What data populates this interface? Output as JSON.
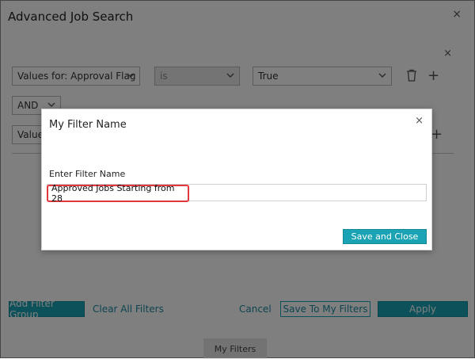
{
  "dialog": {
    "title": "Advanced Job Search",
    "close_glyph": "×",
    "inner_close_glyph": "×"
  },
  "filter_row_1": {
    "field_label": "Values for:  Approval Flag",
    "operator": "is",
    "value": "True",
    "add_glyph": "+"
  },
  "conjunction": {
    "value": "AND"
  },
  "filter_row_2": {
    "field_label": "Values",
    "add_glyph": "+"
  },
  "footer": {
    "add_filter_group": "Add Filter Group",
    "clear_all_filters": "Clear All Filters",
    "cancel": "Cancel",
    "save_to_my_filters": "Save To My Filters",
    "apply": "Apply"
  },
  "tabs": {
    "my_filters": "My Filters"
  },
  "modal": {
    "title": "My Filter Name",
    "close_glyph": "×",
    "field_label": "Enter Filter Name",
    "field_value": "Approved Jobs Starting from 28",
    "save_and_close": "Save and Close"
  },
  "colors": {
    "accent": "#1aa3b5",
    "highlight_border": "#e2373f",
    "overlay": "rgba(0,0,0,0.5)"
  },
  "icons": [
    "close-icon",
    "chevron-down-icon",
    "trash-icon",
    "plus-icon"
  ]
}
